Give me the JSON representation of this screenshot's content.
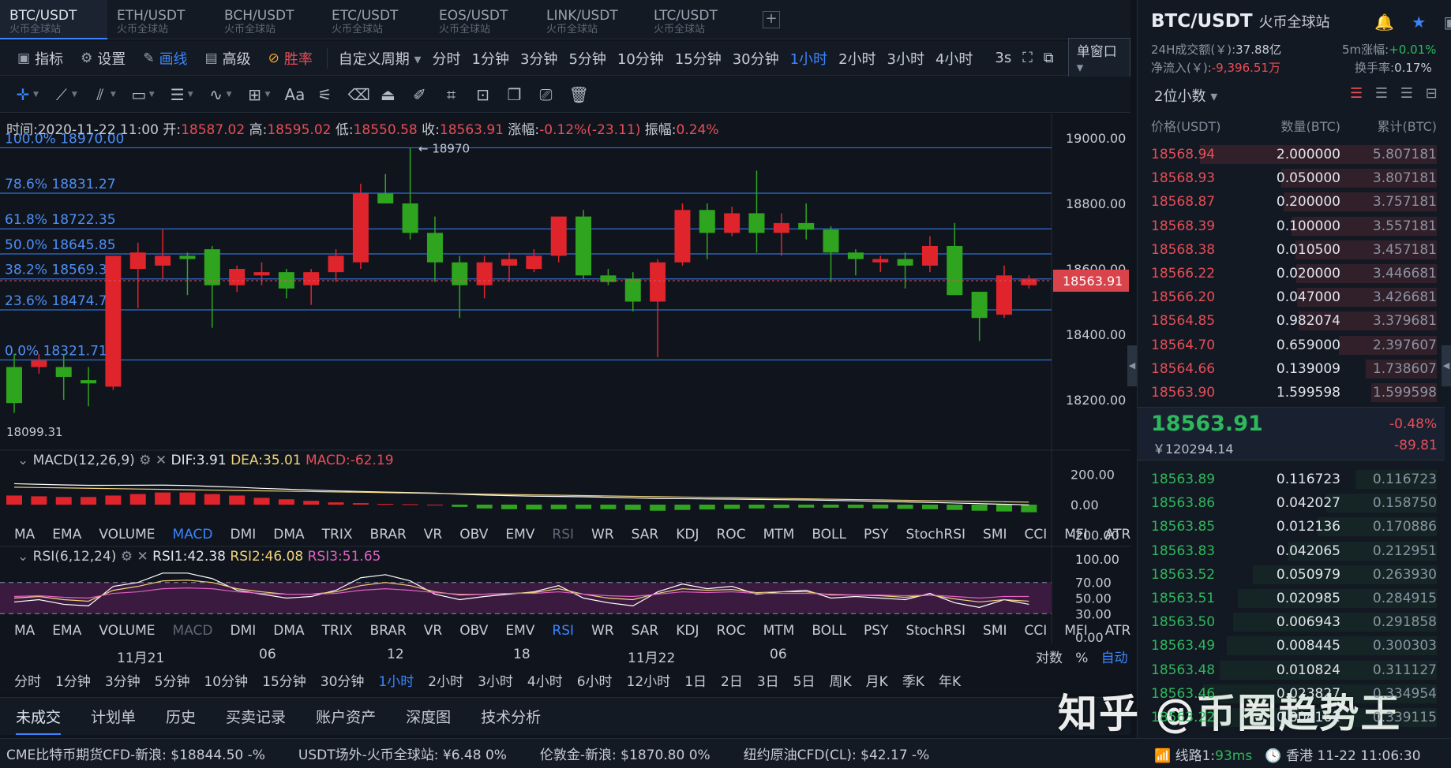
{
  "pair_tabs": [
    {
      "name": "BTC/USDT",
      "sub": "火币全球站",
      "active": true
    },
    {
      "name": "ETH/USDT",
      "sub": "火币全球站"
    },
    {
      "name": "BCH/USDT",
      "sub": "火币全球站"
    },
    {
      "name": "ETC/USDT",
      "sub": "火币全球站"
    },
    {
      "name": "EOS/USDT",
      "sub": "火币全球站"
    },
    {
      "name": "LINK/USDT",
      "sub": "火币全球站"
    },
    {
      "name": "LTC/USDT",
      "sub": "火币全球站"
    }
  ],
  "toolbar": {
    "indicator": "指标",
    "settings": "设置",
    "draw": "画线",
    "advanced": "高级",
    "winrate": "胜率",
    "custom_period": "自定义周期",
    "periods": [
      "分时",
      "1分钟",
      "3分钟",
      "5分钟",
      "10分钟",
      "15分钟",
      "30分钟",
      "1小时",
      "2小时",
      "3小时",
      "4小时"
    ],
    "active_period": "1小时",
    "refresh": "3s",
    "window_mode": "单窗口"
  },
  "info_line": {
    "time_label": "时间:",
    "time": "2020-11-22 11:00",
    "open_label": "开:",
    "open": "18587.02",
    "high_label": "高:",
    "high": "18595.02",
    "low_label": "低:",
    "low": "18550.58",
    "close_label": "收:",
    "close": "18563.91",
    "chg_label": "涨幅:",
    "chg": "-0.12%(-23.11)",
    "amp_label": "振幅:",
    "amp": "0.24%"
  },
  "fib_labels": [
    "100.0% 18970.00",
    "78.6% 18831.27",
    "61.8% 18722.35",
    "50.0% 18645.85",
    "38.2% 18569.36",
    "23.6% 18474.71",
    "0.0% 18321.71"
  ],
  "price_marks": {
    "max": "18970",
    "min": "18099.31",
    "current": "18563.91"
  },
  "macd_legend": {
    "name": "MACD(12,26,9)",
    "dif": "DIF:3.91",
    "dea": "DEA:35.01",
    "macd": "MACD:-62.19"
  },
  "rsi_legend": {
    "name": "RSI(6,12,24)",
    "rsi1": "RSI1:42.38",
    "rsi2": "RSI2:46.08",
    "rsi3": "RSI3:51.65"
  },
  "indicator_tabs": [
    "MA",
    "EMA",
    "VOLUME",
    "MACD",
    "DMI",
    "DMA",
    "TRIX",
    "BRAR",
    "VR",
    "OBV",
    "EMV",
    "RSI",
    "WR",
    "SAR",
    "KDJ",
    "ROC",
    "MTM",
    "BOLL",
    "PSY",
    "StochRSI",
    "SMI",
    "CCI",
    "MFI",
    "ATR"
  ],
  "time_axis": [
    "11月21",
    "06",
    "12",
    "18",
    "11月22",
    "06"
  ],
  "axis_options": {
    "log": "对数",
    "pct": "%",
    "auto": "自动"
  },
  "bottom_periods": [
    "分时",
    "1分钟",
    "3分钟",
    "5分钟",
    "10分钟",
    "15分钟",
    "30分钟",
    "1小时",
    "2小时",
    "3小时",
    "4小时",
    "6小时",
    "12小时",
    "1日",
    "2日",
    "3日",
    "5日",
    "周K",
    "月K",
    "季K",
    "年K"
  ],
  "order_tabs": [
    "未成交",
    "计划单",
    "历史",
    "买卖记录",
    "账户资产",
    "深度图",
    "技术分析"
  ],
  "tickers": [
    "CME比特币期货CFD-新浪: $18844.50 -%",
    "USDT场外-火币全球站: ¥6.48 0%",
    "伦敦金-新浪: $1870.80 0%",
    "纽约原油CFD(CL): $42.17 -%"
  ],
  "right": {
    "symbol": "BTC/USDT",
    "exchange": "火币全球站",
    "vol_label": "24H成交额(￥):",
    "vol": "37.88亿",
    "rise_label": "5m涨幅:",
    "rise": "+0.01%",
    "flow_label": "净流入(￥):",
    "flow": "-9,396.51万",
    "turnover_label": "换手率:",
    "turnover": "0.17%",
    "precision": "2位小数",
    "ob_headers": [
      "价格(USDT)",
      "数量(BTC)",
      "累计(BTC)"
    ],
    "asks": [
      [
        "18568.94",
        "2.000000",
        "5.807181"
      ],
      [
        "18568.93",
        "0.050000",
        "3.807181"
      ],
      [
        "18568.87",
        "0.200000",
        "3.757181"
      ],
      [
        "18568.39",
        "0.100000",
        "3.557181"
      ],
      [
        "18568.38",
        "0.010500",
        "3.457181"
      ],
      [
        "18566.22",
        "0.020000",
        "3.446681"
      ],
      [
        "18566.20",
        "0.047000",
        "3.426681"
      ],
      [
        "18564.85",
        "0.982074",
        "3.379681"
      ],
      [
        "18564.70",
        "0.659000",
        "2.397607"
      ],
      [
        "18564.66",
        "0.139009",
        "1.738607"
      ],
      [
        "18563.90",
        "1.599598",
        "1.599598"
      ]
    ],
    "last_price": "18563.91",
    "last_cny": "￥120294.14",
    "last_pct": "-0.48%",
    "last_chg": "-89.81",
    "bids": [
      [
        "18563.89",
        "0.116723",
        "0.116723"
      ],
      [
        "18563.86",
        "0.042027",
        "0.158750"
      ],
      [
        "18563.85",
        "0.012136",
        "0.170886"
      ],
      [
        "18563.83",
        "0.042065",
        "0.212951"
      ],
      [
        "18563.52",
        "0.050979",
        "0.263930"
      ],
      [
        "18563.51",
        "0.020985",
        "0.284915"
      ],
      [
        "18563.50",
        "0.006943",
        "0.291858"
      ],
      [
        "18563.49",
        "0.008445",
        "0.300303"
      ],
      [
        "18563.48",
        "0.010824",
        "0.311127"
      ],
      [
        "18563.46",
        "0.023827",
        "0.334954"
      ],
      [
        "18563.22",
        "0.004161",
        "0.339115"
      ]
    ],
    "status_line": "线路1:",
    "latency": "93ms",
    "clock": "香港 11-22 11:06:30"
  },
  "watermark": "知乎 @币圈趋势王",
  "chart_data": [
    {
      "type": "candlestick",
      "title": "BTC/USDT 1小时",
      "y_ticks": [
        19000,
        18800,
        18600,
        18400,
        18200
      ],
      "ylim": [
        18060,
        19050
      ],
      "fib_levels": [
        18970.0,
        18831.27,
        18722.35,
        18645.85,
        18569.36,
        18474.71,
        18321.71
      ],
      "candles": [
        [
          18300,
          18340,
          18160,
          18190
        ],
        [
          18300,
          18340,
          18280,
          18320
        ],
        [
          18300,
          18340,
          18200,
          18270
        ],
        [
          18260,
          18300,
          18180,
          18250
        ],
        [
          18240,
          18640,
          18230,
          18640
        ],
        [
          18600,
          18680,
          18480,
          18650
        ],
        [
          18610,
          18720,
          18570,
          18640
        ],
        [
          18640,
          18650,
          18520,
          18630
        ],
        [
          18660,
          18670,
          18420,
          18550
        ],
        [
          18550,
          18610,
          18530,
          18600
        ],
        [
          18580,
          18620,
          18550,
          18590
        ],
        [
          18590,
          18600,
          18510,
          18540
        ],
        [
          18550,
          18600,
          18490,
          18590
        ],
        [
          18590,
          18660,
          18560,
          18640
        ],
        [
          18620,
          18860,
          18600,
          18830
        ],
        [
          18830,
          18890,
          18800,
          18800
        ],
        [
          18800,
          18970,
          18690,
          18710
        ],
        [
          18710,
          18760,
          18560,
          18620
        ],
        [
          18620,
          18640,
          18450,
          18550
        ],
        [
          18550,
          18640,
          18510,
          18620
        ],
        [
          18610,
          18650,
          18560,
          18630
        ],
        [
          18600,
          18660,
          18590,
          18640
        ],
        [
          18640,
          18760,
          18620,
          18760
        ],
        [
          18760,
          18780,
          18570,
          18580
        ],
        [
          18580,
          18600,
          18550,
          18560
        ],
        [
          18570,
          18590,
          18470,
          18500
        ],
        [
          18500,
          18630,
          18330,
          18620
        ],
        [
          18620,
          18800,
          18610,
          18780
        ],
        [
          18780,
          18800,
          18630,
          18710
        ],
        [
          18710,
          18790,
          18700,
          18770
        ],
        [
          18770,
          18900,
          18650,
          18710
        ],
        [
          18710,
          18770,
          18640,
          18740
        ],
        [
          18740,
          18800,
          18690,
          18720
        ],
        [
          18720,
          18730,
          18560,
          18650
        ],
        [
          18650,
          18660,
          18580,
          18630
        ],
        [
          18620,
          18640,
          18590,
          18630
        ],
        [
          18630,
          18650,
          18540,
          18610
        ],
        [
          18610,
          18700,
          18590,
          18670
        ],
        [
          18670,
          18740,
          18520,
          18520
        ],
        [
          18530,
          18530,
          18380,
          18450
        ],
        [
          18460,
          18610,
          18450,
          18580
        ],
        [
          18550,
          18580,
          18540,
          18570
        ]
      ]
    },
    {
      "type": "bar",
      "title": "MACD(12,26,9)",
      "y_ticks": [
        200,
        0,
        -200
      ],
      "values": [
        60,
        55,
        50,
        50,
        60,
        70,
        80,
        80,
        70,
        60,
        45,
        35,
        25,
        15,
        10,
        5,
        3,
        0,
        -15,
        -25,
        -30,
        -32,
        -30,
        -28,
        -30,
        -35,
        -40,
        -35,
        -32,
        -28,
        -25,
        -22,
        -20,
        -20,
        -22,
        -25,
        -28,
        -30,
        -35,
        -40,
        -45,
        -50
      ]
    },
    {
      "type": "line",
      "title": "RSI(6,12,24)",
      "y_ticks": [
        100,
        70,
        50,
        30,
        0
      ],
      "series": [
        {
          "name": "RSI1",
          "values": [
            45,
            48,
            42,
            40,
            65,
            70,
            82,
            82,
            75,
            60,
            55,
            50,
            52,
            60,
            76,
            80,
            72,
            55,
            48,
            52,
            55,
            58,
            66,
            50,
            44,
            40,
            58,
            68,
            62,
            65,
            55,
            58,
            60,
            50,
            52,
            50,
            48,
            56,
            44,
            38,
            48,
            42
          ]
        },
        {
          "name": "RSI2",
          "values": [
            50,
            52,
            48,
            46,
            60,
            65,
            72,
            73,
            70,
            62,
            58,
            55,
            55,
            58,
            66,
            70,
            66,
            58,
            54,
            55,
            56,
            57,
            62,
            55,
            50,
            48,
            56,
            62,
            60,
            61,
            57,
            58,
            58,
            54,
            54,
            53,
            51,
            54,
            49,
            45,
            48,
            46
          ]
        },
        {
          "name": "RSI3",
          "values": [
            52,
            53,
            51,
            50,
            56,
            58,
            62,
            63,
            62,
            58,
            56,
            55,
            55,
            56,
            60,
            62,
            60,
            57,
            55,
            55,
            56,
            56,
            58,
            55,
            53,
            52,
            55,
            58,
            57,
            58,
            56,
            56,
            56,
            55,
            54,
            54,
            53,
            54,
            52,
            50,
            52,
            52
          ]
        }
      ]
    }
  ]
}
